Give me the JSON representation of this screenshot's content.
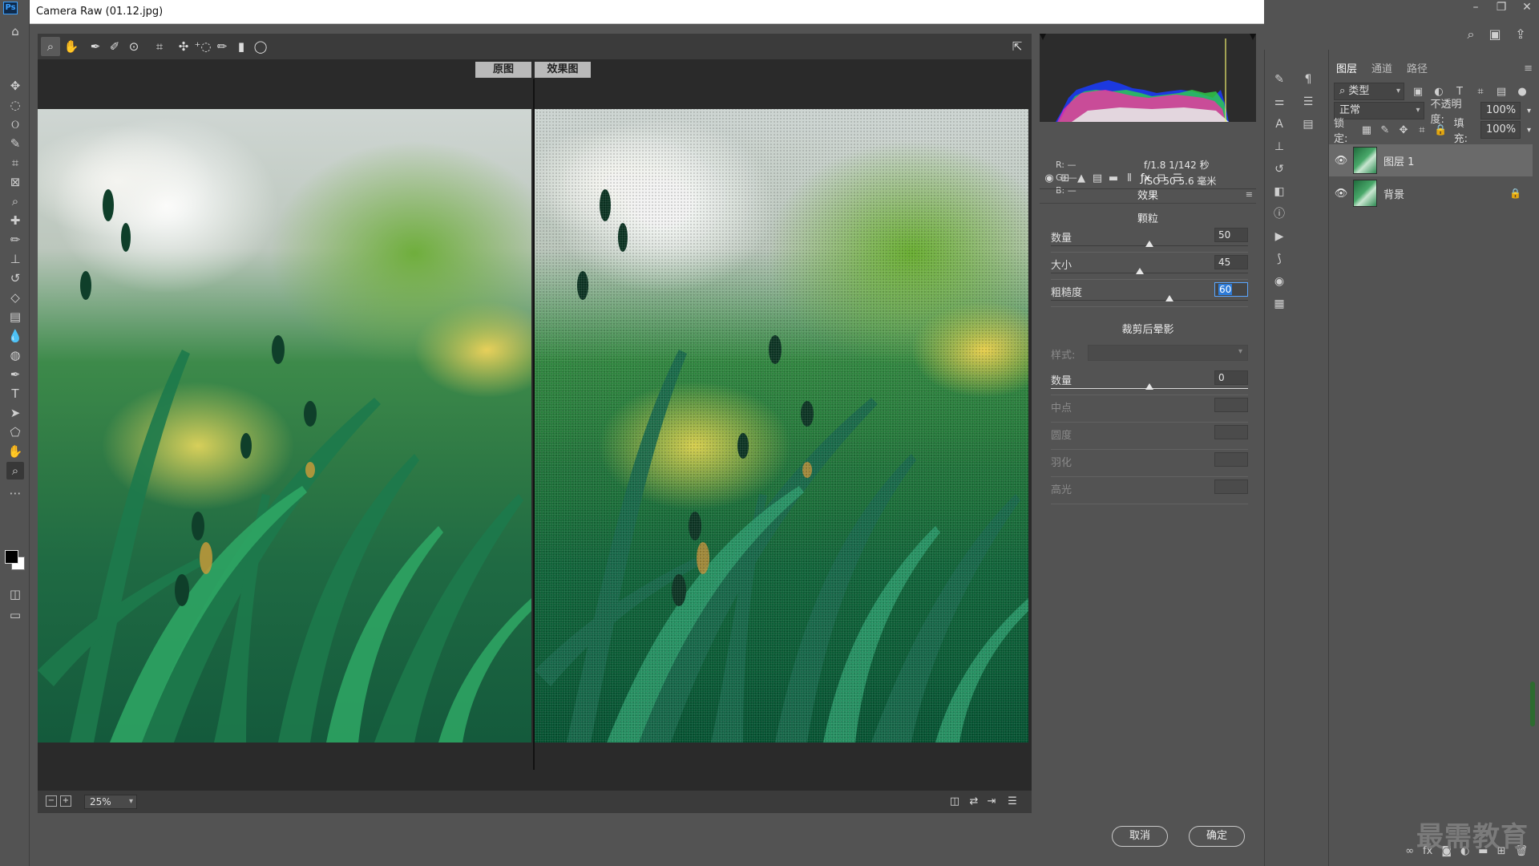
{
  "dialog": {
    "title": "Camera Raw (01.12.jpg)",
    "cancel_label": "取消",
    "ok_label": "确定"
  },
  "toolbar": {
    "tools": [
      "zoom-icon",
      "hand-icon",
      "white-balance-icon",
      "color-sampler-icon",
      "targeted-adjustment-icon",
      "crop-icon",
      "straighten-icon",
      "spot-removal-icon",
      "red-eye-icon",
      "adjustment-brush-icon",
      "graduated-filter-icon",
      "radial-filter-icon"
    ],
    "fullscreen_icon": "fullscreen-toggle-icon"
  },
  "preview": {
    "before_label": "原图",
    "after_label": "效果图"
  },
  "statusbar": {
    "zoom": "25%"
  },
  "histogram": {
    "r_label": "R:",
    "g_label": "G:",
    "b_label": "B:",
    "r_value": "—",
    "g_value": "—",
    "b_value": "—",
    "exif_line1": "f/1.8  1/142 秒",
    "exif_line2": "ISO 50  5.6 毫米"
  },
  "effects_panel": {
    "title": "效果",
    "grain": {
      "title": "颗粒",
      "amount_label": "数量",
      "amount_value": "50",
      "amount_fraction": 0.5,
      "size_label": "大小",
      "size_value": "45",
      "size_fraction": 0.45,
      "roughness_label": "粗糙度",
      "roughness_value": "60",
      "roughness_fraction": 0.6
    },
    "vignette": {
      "title": "裁剪后晕影",
      "style_label": "样式:",
      "amount_label": "数量",
      "amount_value": "0",
      "amount_fraction": 0.5,
      "midpoint_label": "中点",
      "roundness_label": "圆度",
      "feather_label": "羽化",
      "highlights_label": "高光"
    }
  },
  "layers_panel": {
    "tabs": [
      "图层",
      "通道",
      "路径"
    ],
    "filter_label": "类型",
    "blend_mode": "正常",
    "opacity_label": "不透明度:",
    "opacity_value": "100%",
    "lock_label": "锁定:",
    "fill_label": "填充:",
    "fill_value": "100%",
    "layers": [
      {
        "name": "图层 1",
        "selected": true
      },
      {
        "name": "背景",
        "locked": true
      }
    ]
  },
  "watermark": "最需教育",
  "colors": {
    "panel_bg": "#535353",
    "preview_bg": "#2a2a2a",
    "accent_focus": "#2d7bd8"
  }
}
